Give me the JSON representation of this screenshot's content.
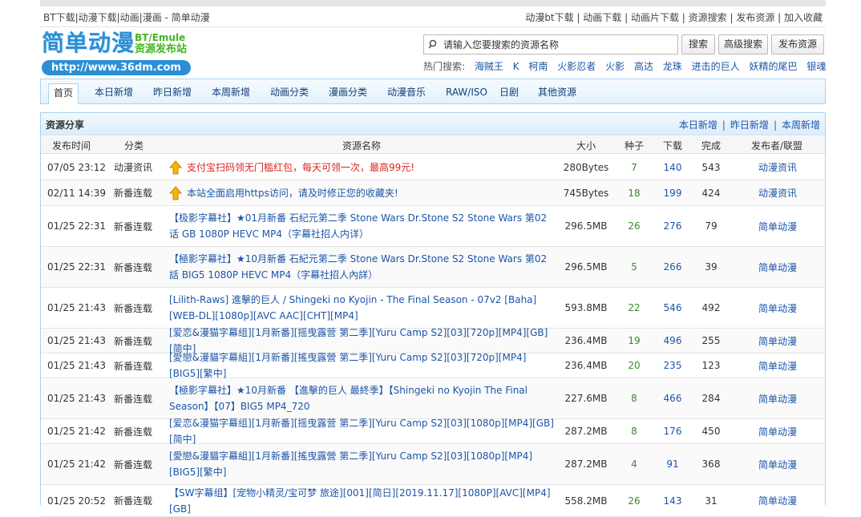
{
  "topbar": {
    "left": "BT下载|动漫下载|动画|漫画 - 简单动漫",
    "right": "动漫bt下载 | 动画下载 | 动画片下载 | 资源搜索 | 发布资源 | 加入收藏"
  },
  "logo": {
    "main": "简单动漫",
    "sub1": "BT/Emule",
    "sub2": "资源发布站",
    "url": "http://www.36dm.com"
  },
  "search": {
    "placeholder": "请输入您要搜索的资源名称",
    "search_btn": "搜索",
    "adv_btn": "高级搜索",
    "publish_btn": "发布资源"
  },
  "hot": {
    "label": "热门搜索:",
    "keywords": [
      "海贼王",
      "K",
      "柯南",
      "火影忍者",
      "火影",
      "高达",
      "龙珠",
      "进击的巨人",
      "妖精的尾巴",
      "银魂"
    ]
  },
  "nav": [
    "首页",
    "本日新增",
    "昨日新增",
    "本周新增",
    "动画分类",
    "漫画分类",
    "动漫音乐",
    "RAW/ISO",
    "日剧",
    "其他资源"
  ],
  "panel": {
    "title": "资源分享",
    "links": [
      "本日新增",
      "昨日新增",
      "本周新增"
    ]
  },
  "columns": [
    "发布时间",
    "分类",
    "资源名称",
    "大小",
    "种子",
    "下载",
    "完成",
    "发布者/联盟"
  ],
  "rows": [
    {
      "time": "07/05 23:12",
      "cat": "动漫资讯",
      "name": "支付宝扫码领无门槛红包，每天可领一次，最高99元!",
      "size": "280Bytes",
      "seed": "7",
      "dl": "140",
      "done": "543",
      "pub": "动漫资讯"
    },
    {
      "time": "02/11 14:39",
      "cat": "新番连载",
      "name": "本站全面启用https访问，请及时修正您的收藏夹!",
      "size": "745Bytes",
      "seed": "18",
      "dl": "199",
      "done": "424",
      "pub": "动漫资讯"
    },
    {
      "time": "01/25 22:31",
      "cat": "新番连载",
      "name": "【极影字幕社】★01月新番 石纪元第二季 Stone Wars Dr.Stone S2 Stone Wars 第02话 GB 1080P HEVC MP4（字幕社招人内详）",
      "size": "296.5MB",
      "seed": "26",
      "dl": "276",
      "done": "79",
      "pub": "简单动漫"
    },
    {
      "time": "01/25 22:31",
      "cat": "新番连载",
      "name": "【極影字幕社】★10月新番 石紀元第二季 Stone Wars Dr.Stone S2 Stone Wars 第02話 BIG5 1080P HEVC MP4（字幕社招人內詳）",
      "size": "296.5MB",
      "seed": "5",
      "dl": "266",
      "done": "39",
      "pub": "简单动漫"
    },
    {
      "time": "01/25 21:43",
      "cat": "新番连载",
      "name": "[Lilith-Raws] 進擊的巨人 / Shingeki no Kyojin - The Final Season - 07v2 [Baha][WEB-DL][1080p][AVC AAC][CHT][MP4]",
      "size": "593.8MB",
      "seed": "22",
      "dl": "546",
      "done": "492",
      "pub": "简单动漫"
    },
    {
      "time": "01/25 21:43",
      "cat": "新番连载",
      "name": "[爱恋&漫猫字幕组][1月新番][摇曳露营 第二季][Yuru Camp S2][03][720p][MP4][GB][简中]",
      "size": "236.4MB",
      "seed": "19",
      "dl": "496",
      "done": "255",
      "pub": "简单动漫"
    },
    {
      "time": "01/25 21:43",
      "cat": "新番连载",
      "name": "[愛戀&漫貓字幕組][1月新番][搖曳露營 第二季][Yuru Camp S2][03][720p][MP4][BIG5][繁中]",
      "size": "236.4MB",
      "seed": "20",
      "dl": "235",
      "done": "123",
      "pub": "简单动漫"
    },
    {
      "time": "01/25 21:43",
      "cat": "新番连载",
      "name": "【極影字幕社】★10月新番 【進擊的巨人 最終季】【Shingeki no Kyojin The Final Season】【07】BIG5 MP4_720",
      "size": "227.6MB",
      "seed": "8",
      "dl": "466",
      "done": "284",
      "pub": "简单动漫"
    },
    {
      "time": "01/25 21:42",
      "cat": "新番连载",
      "name": "[爱恋&漫猫字幕组][1月新番][摇曳露营 第二季][Yuru Camp S2][03][1080p][MP4][GB][简中]",
      "size": "287.2MB",
      "seed": "8",
      "dl": "176",
      "done": "450",
      "pub": "简单动漫"
    },
    {
      "time": "01/25 21:42",
      "cat": "新番连载",
      "name": "[愛戀&漫貓字幕組][1月新番][搖曳露營 第二季][Yuru Camp S2][03][1080p][MP4][BIG5][繁中]",
      "size": "287.2MB",
      "seed": "4",
      "dl": "91",
      "done": "368",
      "pub": "简单动漫"
    },
    {
      "time": "01/25 20:52",
      "cat": "新番连载",
      "name": "【SW字幕组】[宠物小精灵/宝可梦 旅途][001][简日][2019.11.17][1080P][AVC][MP4][GB]",
      "size": "558.2MB",
      "seed": "26",
      "dl": "143",
      "done": "31",
      "pub": "简单动漫"
    }
  ],
  "colors": {
    "accent": "#2a8fd6",
    "link": "#1b55a8",
    "highlight": "#dd2222",
    "seed": "#3a8a25",
    "nav_border": "#a9d3ee"
  }
}
